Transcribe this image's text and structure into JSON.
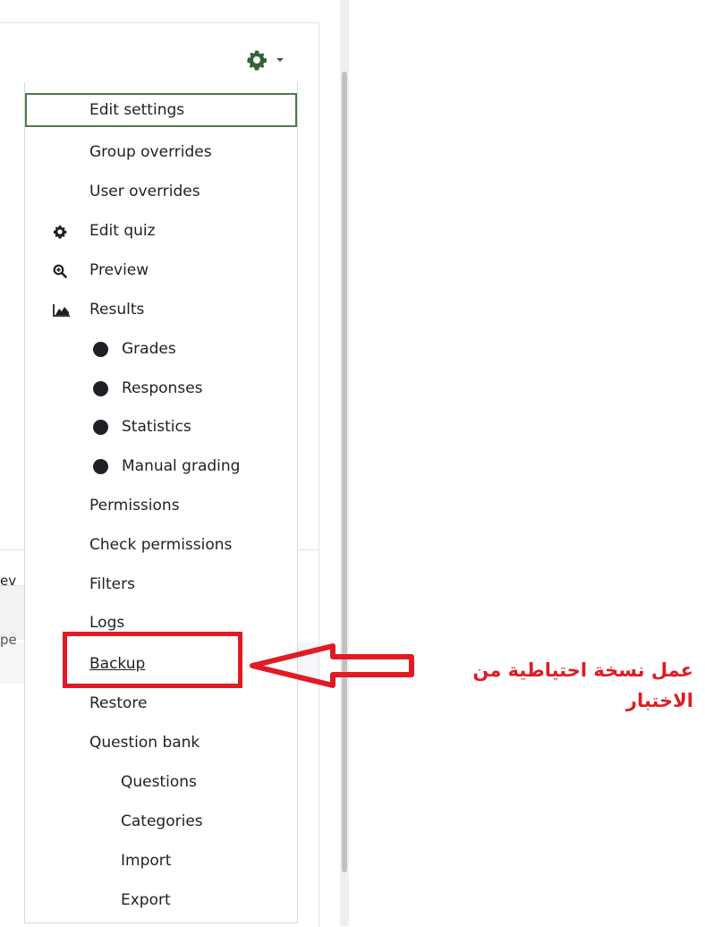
{
  "background": {
    "partial_text_1": "ev",
    "partial_text_2": "pe"
  },
  "menu": {
    "items": [
      {
        "label": "Edit settings"
      },
      {
        "label": "Group overrides"
      },
      {
        "label": "User overrides"
      },
      {
        "label": "Edit quiz",
        "icon": "gear-icon"
      },
      {
        "label": "Preview",
        "icon": "zoom-in-icon"
      },
      {
        "label": "Results",
        "icon": "area-chart-icon"
      },
      {
        "label": "Grades",
        "icon": "bullet-icon"
      },
      {
        "label": "Responses",
        "icon": "bullet-icon"
      },
      {
        "label": "Statistics",
        "icon": "bullet-icon"
      },
      {
        "label": "Manual grading",
        "icon": "bullet-icon"
      },
      {
        "label": "Permissions"
      },
      {
        "label": "Check permissions"
      },
      {
        "label": "Filters"
      },
      {
        "label": "Logs"
      },
      {
        "label": "Backup"
      },
      {
        "label": "Restore"
      },
      {
        "label": "Question bank"
      },
      {
        "label": "Questions"
      },
      {
        "label": "Categories"
      },
      {
        "label": "Import"
      },
      {
        "label": "Export"
      }
    ]
  },
  "annotation": {
    "line1": "عمل نسخة احتياطية من",
    "line2": "الاختبار"
  },
  "colors": {
    "accent_green": "#32623a",
    "focus_border": "#4b7c4e",
    "annotation_red": "#e01b24"
  }
}
